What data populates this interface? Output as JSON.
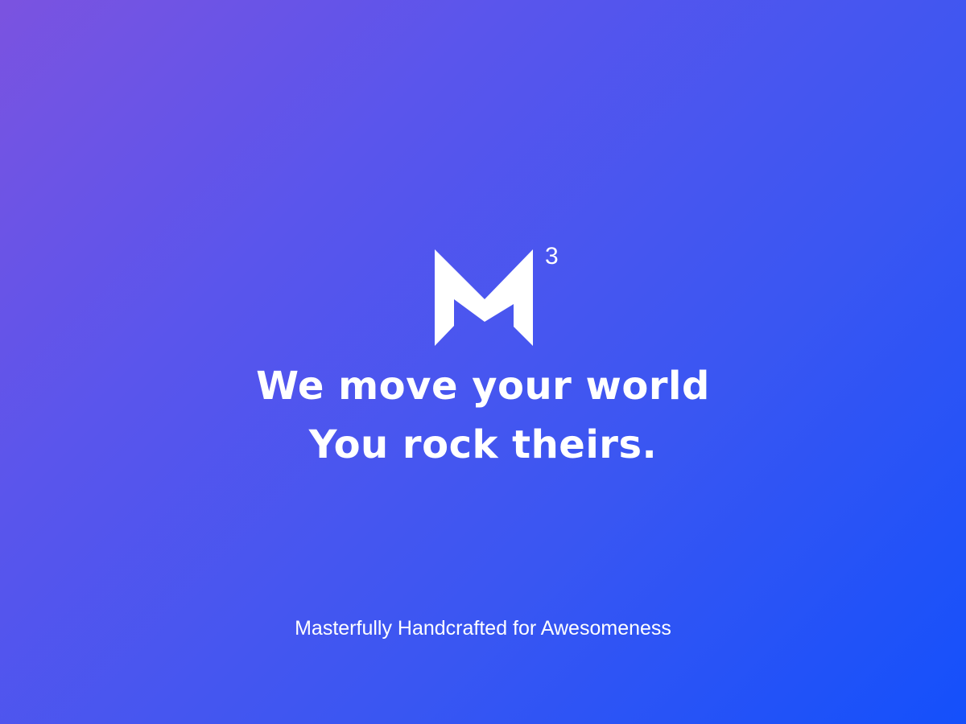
{
  "brand": {
    "logo_letter": "M",
    "logo_superscript": "3",
    "logo_icon": "m3-logo-icon"
  },
  "headline": {
    "line1": "We move your world",
    "line2": "You rock theirs."
  },
  "footer": {
    "tagline": "Masterfully Handcrafted for Awesomeness"
  },
  "colors": {
    "gradient_start": "#7b53e0",
    "gradient_end": "#1450fb",
    "text": "#ffffff"
  }
}
